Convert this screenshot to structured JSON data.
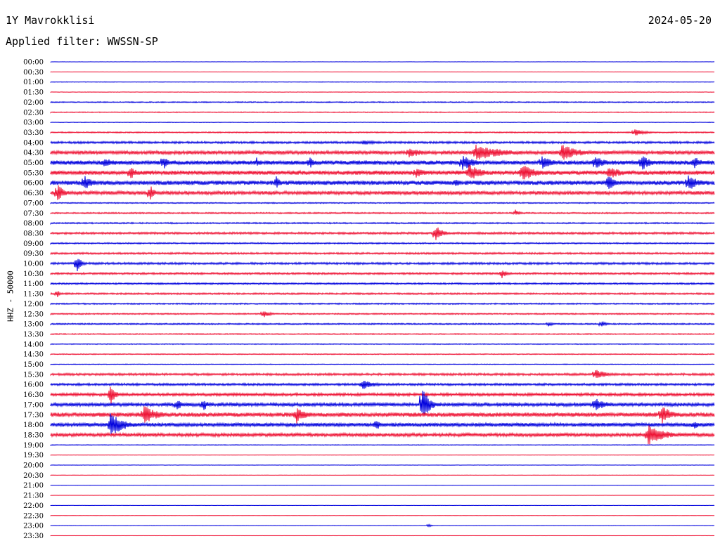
{
  "header": {
    "station": "1Y Mavrokklisi",
    "date": "2024-05-20",
    "filter": "Applied filter: WWSSN-SP"
  },
  "chart_data": {
    "type": "line",
    "title": "1Y Mavrokklisi",
    "ylabel": "HHZ - 50000",
    "colors": [
      "#0000dd",
      "#ee1133"
    ],
    "rows": [
      "00:00",
      "00:30",
      "01:00",
      "01:30",
      "02:00",
      "02:30",
      "03:00",
      "03:30",
      "04:00",
      "04:30",
      "05:00",
      "05:30",
      "06:00",
      "06:30",
      "07:00",
      "07:30",
      "08:00",
      "08:30",
      "09:00",
      "09:30",
      "10:00",
      "10:30",
      "11:00",
      "11:30",
      "12:00",
      "12:30",
      "13:00",
      "13:30",
      "14:00",
      "14:30",
      "15:00",
      "15:30",
      "16:00",
      "16:30",
      "17:00",
      "17:30",
      "18:00",
      "18:30",
      "19:00",
      "19:30",
      "20:00",
      "20:30",
      "21:00",
      "21:30",
      "22:00",
      "22:30",
      "23:00",
      "23:30"
    ],
    "activity": [
      0.2,
      0.2,
      0.4,
      0.4,
      0.8,
      0.7,
      0.4,
      0.9,
      1.5,
      2.5,
      3.0,
      3.0,
      3.0,
      2.5,
      0.8,
      1.0,
      1.0,
      1.5,
      1.0,
      1.3,
      1.5,
      1.4,
      1.2,
      1.2,
      1.0,
      1.0,
      1.0,
      0.8,
      0.7,
      0.7,
      0.5,
      1.6,
      1.6,
      2.0,
      2.4,
      3.0,
      2.6,
      2.4,
      0.6,
      0.3,
      0.3,
      0.3,
      0.2,
      0.2,
      0.2,
      0.3,
      0.3,
      0.2
    ],
    "events": [
      {
        "row": "03:30",
        "t": 0.88,
        "amp": 5,
        "dur": 0.05
      },
      {
        "row": "04:00",
        "t": 0.47,
        "amp": 4,
        "dur": 0.06
      },
      {
        "row": "04:30",
        "t": 0.54,
        "amp": 8,
        "dur": 0.06
      },
      {
        "row": "04:30",
        "t": 0.64,
        "amp": 12,
        "dur": 0.12
      },
      {
        "row": "04:30",
        "t": 0.77,
        "amp": 12,
        "dur": 0.08
      },
      {
        "row": "05:00",
        "t": 0.08,
        "amp": 9,
        "dur": 0.04
      },
      {
        "row": "05:00",
        "t": 0.17,
        "amp": 12,
        "dur": 0.02
      },
      {
        "row": "05:00",
        "t": 0.31,
        "amp": 8,
        "dur": 0.02
      },
      {
        "row": "05:00",
        "t": 0.39,
        "amp": 10,
        "dur": 0.02
      },
      {
        "row": "05:00",
        "t": 0.62,
        "amp": 12,
        "dur": 0.05
      },
      {
        "row": "05:00",
        "t": 0.74,
        "amp": 10,
        "dur": 0.05
      },
      {
        "row": "05:00",
        "t": 0.82,
        "amp": 12,
        "dur": 0.04
      },
      {
        "row": "05:00",
        "t": 0.89,
        "amp": 12,
        "dur": 0.04
      },
      {
        "row": "05:00",
        "t": 0.97,
        "amp": 10,
        "dur": 0.03
      },
      {
        "row": "05:30",
        "t": 0.12,
        "amp": 10,
        "dur": 0.03
      },
      {
        "row": "05:30",
        "t": 0.55,
        "amp": 8,
        "dur": 0.05
      },
      {
        "row": "05:30",
        "t": 0.63,
        "amp": 12,
        "dur": 0.06
      },
      {
        "row": "05:30",
        "t": 0.71,
        "amp": 14,
        "dur": 0.06
      },
      {
        "row": "05:30",
        "t": 0.84,
        "amp": 10,
        "dur": 0.06
      },
      {
        "row": "06:00",
        "t": 0.05,
        "amp": 12,
        "dur": 0.04
      },
      {
        "row": "06:00",
        "t": 0.34,
        "amp": 10,
        "dur": 0.02
      },
      {
        "row": "06:00",
        "t": 0.61,
        "amp": 8,
        "dur": 0.02
      },
      {
        "row": "06:00",
        "t": 0.84,
        "amp": 12,
        "dur": 0.03
      },
      {
        "row": "06:00",
        "t": 0.96,
        "amp": 12,
        "dur": 0.05
      },
      {
        "row": "06:30",
        "t": 0.01,
        "amp": 14,
        "dur": 0.03
      },
      {
        "row": "06:30",
        "t": 0.15,
        "amp": 12,
        "dur": 0.02
      },
      {
        "row": "07:30",
        "t": 0.7,
        "amp": 5,
        "dur": 0.02
      },
      {
        "row": "08:30",
        "t": 0.58,
        "amp": 12,
        "dur": 0.03
      },
      {
        "row": "10:00",
        "t": 0.04,
        "amp": 12,
        "dur": 0.02
      },
      {
        "row": "10:30",
        "t": 0.68,
        "amp": 8,
        "dur": 0.02
      },
      {
        "row": "11:30",
        "t": 0.01,
        "amp": 6,
        "dur": 0.01
      },
      {
        "row": "12:30",
        "t": 0.32,
        "amp": 6,
        "dur": 0.03
      },
      {
        "row": "13:00",
        "t": 0.75,
        "amp": 4,
        "dur": 0.02
      },
      {
        "row": "13:00",
        "t": 0.83,
        "amp": 5,
        "dur": 0.02
      },
      {
        "row": "15:30",
        "t": 0.82,
        "amp": 8,
        "dur": 0.05
      },
      {
        "row": "16:00",
        "t": 0.47,
        "amp": 8,
        "dur": 0.05
      },
      {
        "row": "16:30",
        "t": 0.09,
        "amp": 16,
        "dur": 0.02
      },
      {
        "row": "17:00",
        "t": 0.19,
        "amp": 10,
        "dur": 0.02
      },
      {
        "row": "17:00",
        "t": 0.23,
        "amp": 10,
        "dur": 0.02
      },
      {
        "row": "17:00",
        "t": 0.56,
        "amp": 26,
        "dur": 0.03
      },
      {
        "row": "17:00",
        "t": 0.82,
        "amp": 10,
        "dur": 0.05
      },
      {
        "row": "17:30",
        "t": 0.14,
        "amp": 14,
        "dur": 0.06
      },
      {
        "row": "17:30",
        "t": 0.37,
        "amp": 14,
        "dur": 0.04
      },
      {
        "row": "17:30",
        "t": 0.92,
        "amp": 16,
        "dur": 0.04
      },
      {
        "row": "18:00",
        "t": 0.09,
        "amp": 18,
        "dur": 0.06
      },
      {
        "row": "18:00",
        "t": 0.49,
        "amp": 10,
        "dur": 0.02
      },
      {
        "row": "18:00",
        "t": 0.97,
        "amp": 8,
        "dur": 0.02
      },
      {
        "row": "18:30",
        "t": 0.9,
        "amp": 16,
        "dur": 0.07
      },
      {
        "row": "23:00",
        "t": 0.57,
        "amp": 3,
        "dur": 0.01
      }
    ]
  }
}
